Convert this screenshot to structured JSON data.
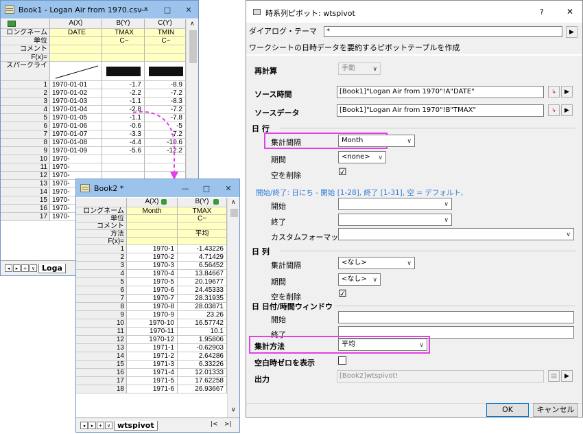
{
  "book1": {
    "title": "Book1 - Logan Air from 1970.csv *",
    "controls": [
      "—",
      "□",
      "✕"
    ],
    "columns": [
      "A(X)",
      "B(Y)",
      "C(Y)"
    ],
    "meta_rows": [
      {
        "label": "ロングネーム",
        "values": [
          "DATE",
          "TMAX",
          "TMIN"
        ]
      },
      {
        "label": "単位",
        "values": [
          "",
          "C−",
          "C−"
        ]
      },
      {
        "label": "コメント",
        "values": [
          "",
          "",
          ""
        ]
      },
      {
        "label": "F(x)=",
        "values": [
          "",
          "",
          ""
        ]
      },
      {
        "label": "スパークライ",
        "values": [
          "",
          "",
          ""
        ]
      }
    ],
    "rows": [
      {
        "n": "1",
        "date": "1970-01-01",
        "tmax": "-1.7",
        "tmin": "-8.9"
      },
      {
        "n": "2",
        "date": "1970-01-02",
        "tmax": "-2.2",
        "tmin": "-7.2"
      },
      {
        "n": "3",
        "date": "1970-01-03",
        "tmax": "-1.1",
        "tmin": "-8.3"
      },
      {
        "n": "4",
        "date": "1970-01-04",
        "tmax": "-2.8",
        "tmin": "-7.2"
      },
      {
        "n": "5",
        "date": "1970-01-05",
        "tmax": "-1.1",
        "tmin": "-7.8"
      },
      {
        "n": "6",
        "date": "1970-01-06",
        "tmax": "-0.6",
        "tmin": "-5"
      },
      {
        "n": "7",
        "date": "1970-01-07",
        "tmax": "-3.3",
        "tmin": "-7.2"
      },
      {
        "n": "8",
        "date": "1970-01-08",
        "tmax": "-4.4",
        "tmin": "-10.6"
      },
      {
        "n": "9",
        "date": "1970-01-09",
        "tmax": "-5.6",
        "tmin": "-12.2"
      },
      {
        "n": "10",
        "date": "1970-",
        "tmax": "",
        "tmin": ""
      },
      {
        "n": "11",
        "date": "1970-",
        "tmax": "",
        "tmin": ""
      },
      {
        "n": "12",
        "date": "1970-",
        "tmax": "",
        "tmin": ""
      },
      {
        "n": "13",
        "date": "1970-",
        "tmax": "",
        "tmin": ""
      },
      {
        "n": "14",
        "date": "1970-",
        "tmax": "",
        "tmin": ""
      },
      {
        "n": "15",
        "date": "1970-",
        "tmax": "",
        "tmin": ""
      },
      {
        "n": "16",
        "date": "1970-",
        "tmax": "",
        "tmin": ""
      },
      {
        "n": "17",
        "date": "1970-",
        "tmax": "",
        "tmin": ""
      }
    ],
    "sheet_tab": "Loga",
    "nav": [
      "◂",
      "▸",
      "+",
      "∨"
    ]
  },
  "book2": {
    "title": "Book2 *",
    "controls": [
      "—",
      "□",
      "✕"
    ],
    "columns": [
      "A(X)",
      "B(Y)"
    ],
    "meta_rows": [
      {
        "label": "ロングネーム",
        "values": [
          "Month",
          "TMAX"
        ]
      },
      {
        "label": "単位",
        "values": [
          "",
          "C−"
        ]
      },
      {
        "label": "コメント",
        "values": [
          "",
          ""
        ]
      },
      {
        "label": "方法",
        "values": [
          "",
          "平均"
        ]
      },
      {
        "label": "F(x)=",
        "values": [
          "",
          ""
        ]
      }
    ],
    "rows": [
      {
        "n": "1",
        "month": "1970-1",
        "tmax": "-1.43226"
      },
      {
        "n": "2",
        "month": "1970-2",
        "tmax": "4.71429"
      },
      {
        "n": "3",
        "month": "1970-3",
        "tmax": "6.56452"
      },
      {
        "n": "4",
        "month": "1970-4",
        "tmax": "13.84667"
      },
      {
        "n": "5",
        "month": "1970-5",
        "tmax": "20.19677"
      },
      {
        "n": "6",
        "month": "1970-6",
        "tmax": "24.45333"
      },
      {
        "n": "7",
        "month": "1970-7",
        "tmax": "28.31935"
      },
      {
        "n": "8",
        "month": "1970-8",
        "tmax": "28.03871"
      },
      {
        "n": "9",
        "month": "1970-9",
        "tmax": "23.26"
      },
      {
        "n": "10",
        "month": "1970-10",
        "tmax": "16.57742"
      },
      {
        "n": "11",
        "month": "1970-11",
        "tmax": "10.1"
      },
      {
        "n": "12",
        "month": "1970-12",
        "tmax": "1.95806"
      },
      {
        "n": "13",
        "month": "1971-1",
        "tmax": "-0.62903"
      },
      {
        "n": "14",
        "month": "1971-2",
        "tmax": "2.64286"
      },
      {
        "n": "15",
        "month": "1971-3",
        "tmax": "6.33226"
      },
      {
        "n": "16",
        "month": "1971-4",
        "tmax": "12.01333"
      },
      {
        "n": "17",
        "month": "1971-5",
        "tmax": "17.62258"
      },
      {
        "n": "18",
        "month": "1971-6",
        "tmax": "26.93667"
      }
    ],
    "sheet_tab": "wtspivot",
    "nav": [
      "◂",
      "▸",
      "+",
      "∨"
    ],
    "scroll": [
      "|<",
      ">|"
    ]
  },
  "dialog": {
    "title": "時系列ピボット: wtspivot",
    "help": "?",
    "close": "✕",
    "theme_label": "ダイアログ・テーマ",
    "theme_value": "*",
    "description": "ワークシートの日時データを要約するピボットテーブルを作成",
    "recalc_label": "再計算",
    "recalc_value": "手動",
    "source_time_label": "ソース時間",
    "source_time_value": "[Book1]\"Logan Air from 1970\"!A\"DATE\"",
    "source_data_label": "ソースデータ",
    "source_data_value": "[Book1]\"Logan Air from 1970\"!B\"TMAX\"",
    "rows_section": "日 行",
    "rows_interval_label": "集計間隔",
    "rows_interval_value": "Month",
    "rows_period_label": "期間",
    "rows_period_value": "<none>",
    "rows_remove_empty_label": "空を削除",
    "rows_remove_empty_checked": "☑",
    "hint": "開始/終了: 日にち - 開始 [1-28], 終了 [1-31], 空 = デフォルト,",
    "start_label": "開始",
    "end_label": "終了",
    "custom_format_label": "カスタムフォーマット",
    "cols_section": "日 列",
    "cols_interval_label": "集計間隔",
    "cols_interval_value": "<なし>",
    "cols_period_label": "期間",
    "cols_period_value": "<なし>",
    "cols_remove_empty_label": "空を削除",
    "window_section": "日 日付/時間ウィンドウ",
    "win_start_label": "開始",
    "win_end_label": "終了",
    "method_label": "集計方法",
    "method_value": "平均",
    "zero_label": "空白時ゼロを表示",
    "output_label": "出力",
    "output_value": "[Book2]wtspivot!",
    "ok": "OK",
    "cancel": "キャンセル",
    "arrow_btn": "▶",
    "dropdown_arrow": "∨"
  },
  "colors": {
    "highlight": "#e53ee8",
    "titlebar": "#9cc3ec",
    "hint": "#2b7bd8"
  }
}
